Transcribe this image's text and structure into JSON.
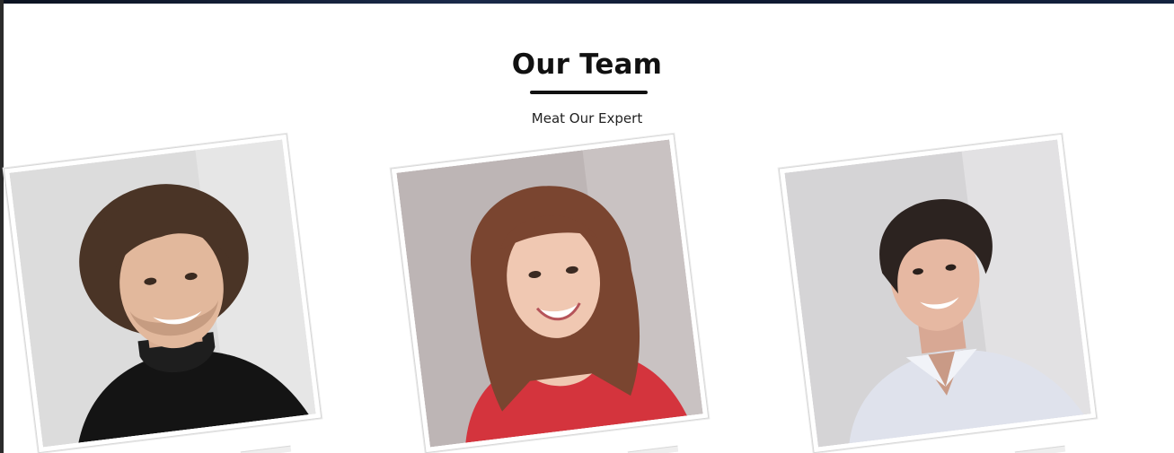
{
  "section": {
    "title": "Our Team",
    "subtitle": "Meat Our Expert"
  },
  "team": [
    {
      "photo_alt": "Smiling man with wavy brown hair in black turtleneck",
      "background": "#d9d9d9",
      "clothing_color": "#141414",
      "hair_color": "#4a3426",
      "skin_color": "#e2b89c"
    },
    {
      "photo_alt": "Smiling woman with long auburn curly hair in red top",
      "background": "#bcb4b4",
      "clothing_color": "#d4343d",
      "hair_color": "#7a4530",
      "skin_color": "#f0c8b2"
    },
    {
      "photo_alt": "Smiling young man with dark hair in light blue shirt",
      "background": "#d4d3d5",
      "clothing_color": "#dfe2ec",
      "hair_color": "#2c2320",
      "skin_color": "#e6b8a2"
    }
  ]
}
